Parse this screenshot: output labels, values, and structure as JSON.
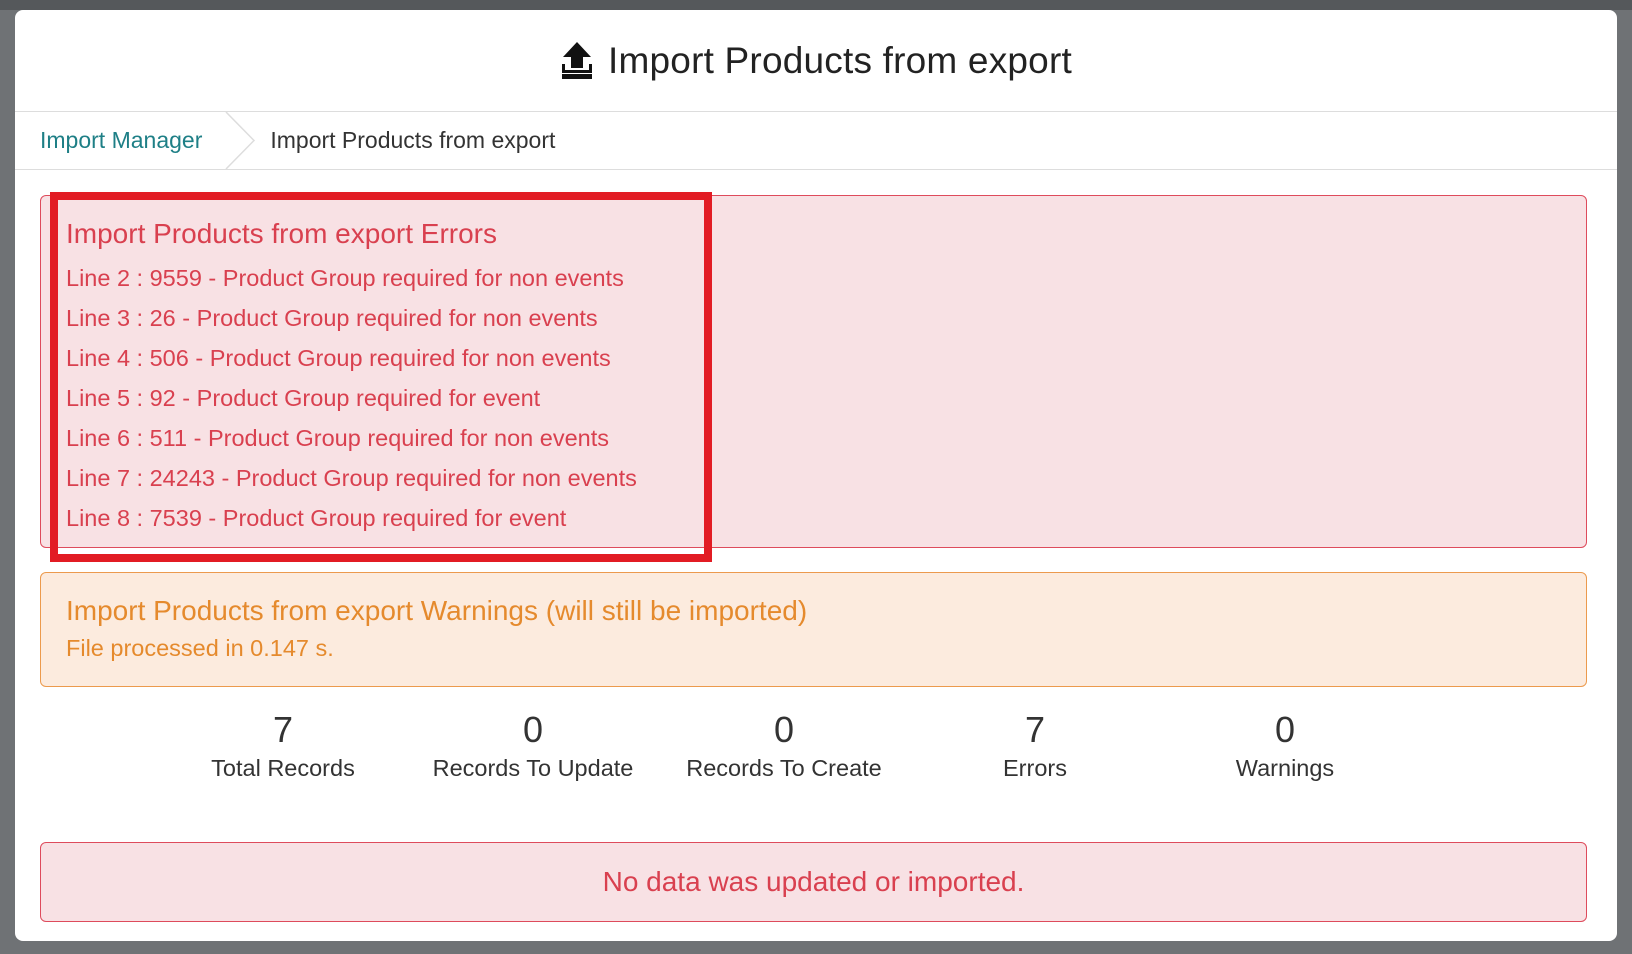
{
  "header": {
    "icon": "upload-icon",
    "title": "Import Products from export"
  },
  "breadcrumb": {
    "parent": "Import Manager",
    "current": "Import Products from export"
  },
  "errors": {
    "title": "Import Products from export Errors",
    "items": [
      "Line 2 : 9559 - Product Group required for non events",
      "Line 3 : 26 - Product Group required for non events",
      "Line 4 : 506 - Product Group required for non events",
      "Line 5 : 92 - Product Group required for event",
      "Line 6 : 511 - Product Group required for non events",
      "Line 7 : 24243 - Product Group required for non events",
      "Line 8 : 7539 - Product Group required for event"
    ]
  },
  "warnings": {
    "title": "Import Products from export Warnings (will still be imported)",
    "text": "File processed in 0.147 s."
  },
  "stats": [
    {
      "value": "7",
      "label": "Total Records"
    },
    {
      "value": "0",
      "label": "Records To Update"
    },
    {
      "value": "0",
      "label": "Records To Create"
    },
    {
      "value": "7",
      "label": "Errors"
    },
    {
      "value": "0",
      "label": "Warnings"
    }
  ],
  "result": {
    "text": "No data was updated or imported."
  },
  "colors": {
    "link": "#1e7f86",
    "error": "#d9404f",
    "error_bg": "#f8e1e4",
    "warning": "#e58a2d",
    "warning_bg": "#fcebde",
    "highlight": "#e21c24"
  }
}
